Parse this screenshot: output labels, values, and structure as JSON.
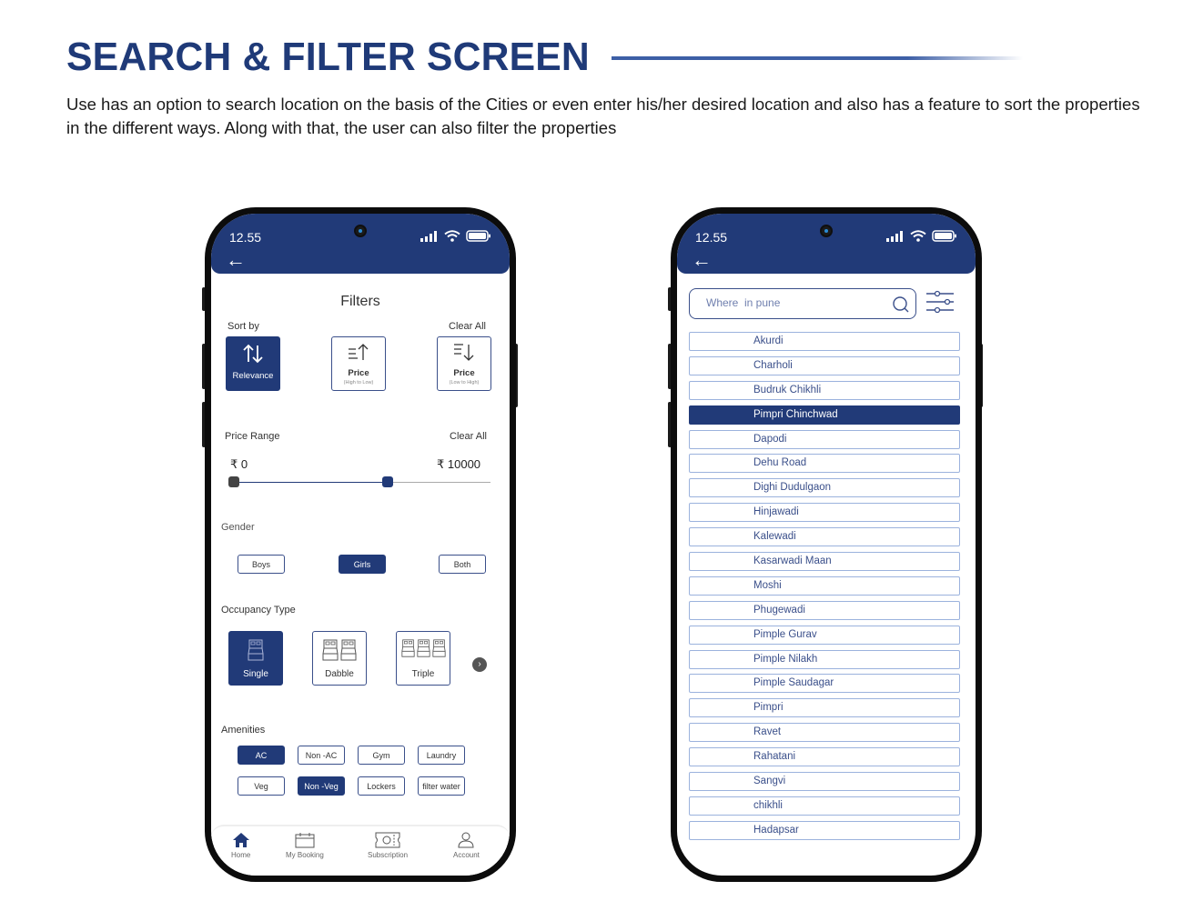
{
  "page": {
    "title": "SEARCH & FILTER SCREEN",
    "description": "Use has an option to search location on the basis of the Cities or even enter his/her desired location and also has a feature to sort the properties in the different ways. Along with that, the user can also filter the properties"
  },
  "colors": {
    "primary": "#213a78",
    "outline": "#3a4f8a",
    "list_border": "#9bb2dd"
  },
  "filter_screen": {
    "status_time": "12.55",
    "title": "Filters",
    "sort": {
      "label": "Sort by",
      "clear": "Clear All",
      "options": [
        {
          "icon": "sort-arrows-icon",
          "label": "Relevance",
          "sub": "",
          "selected": true
        },
        {
          "icon": "sort-ascending-icon",
          "label": "Price",
          "sub": "(High to Low)",
          "selected": false
        },
        {
          "icon": "sort-descending-icon",
          "label": "Price",
          "sub": "(Low to High)",
          "selected": false
        }
      ]
    },
    "price_range": {
      "label": "Price Range",
      "clear": "Clear All",
      "min_label": "₹ 0",
      "max_label": "₹ 10000",
      "min": 0,
      "max": 10000,
      "selected_min_fraction": 0.0,
      "selected_max_fraction": 0.6
    },
    "gender": {
      "label": "Gender",
      "options": [
        {
          "label": "Boys",
          "selected": false
        },
        {
          "label": "Girls",
          "selected": true
        },
        {
          "label": "Both",
          "selected": false
        }
      ]
    },
    "occupancy": {
      "label": "Occupancy Type",
      "options": [
        {
          "label": "Single",
          "beds": 1,
          "selected": true
        },
        {
          "label": "Dabble",
          "beds": 2,
          "selected": false
        },
        {
          "label": "Triple",
          "beds": 3,
          "selected": false
        }
      ],
      "next_icon": "chevron-right-icon"
    },
    "amenities": {
      "label": "Amenities",
      "options": [
        {
          "label": "AC",
          "selected": true
        },
        {
          "label": "Non -AC",
          "selected": false
        },
        {
          "label": "Gym",
          "selected": false
        },
        {
          "label": "Laundry",
          "selected": false
        },
        {
          "label": "Veg",
          "selected": false
        },
        {
          "label": "Non -Veg",
          "selected": true
        },
        {
          "label": "Lockers",
          "selected": false
        },
        {
          "label": "filter water",
          "selected": false
        }
      ]
    },
    "nav": [
      {
        "label": "Home",
        "icon": "home-icon",
        "active": true
      },
      {
        "label": "My Booking",
        "icon": "calendar-icon",
        "active": false
      },
      {
        "label": "Subscription",
        "icon": "ticket-icon",
        "active": false
      },
      {
        "label": "Account",
        "icon": "user-icon",
        "active": false
      }
    ]
  },
  "search_screen": {
    "status_time": "12.55",
    "search": {
      "placeholder": "Where  in pune",
      "value": ""
    },
    "locations": [
      {
        "name": "Akurdi",
        "selected": false
      },
      {
        "name": "Charholi",
        "selected": false
      },
      {
        "name": "Budruk Chikhli",
        "selected": false
      },
      {
        "name": "Pimpri Chinchwad",
        "selected": true
      },
      {
        "name": "Dapodi",
        "selected": false
      },
      {
        "name": "Dehu Road",
        "selected": false
      },
      {
        "name": "Dighi Dudulgaon",
        "selected": false
      },
      {
        "name": "Hinjawadi",
        "selected": false
      },
      {
        "name": "Kalewadi",
        "selected": false
      },
      {
        "name": "Kasarwadi Maan",
        "selected": false
      },
      {
        "name": "Moshi",
        "selected": false
      },
      {
        "name": "Phugewadi",
        "selected": false
      },
      {
        "name": "Pimple Gurav",
        "selected": false
      },
      {
        "name": "Pimple Nilakh",
        "selected": false
      },
      {
        "name": "Pimple Saudagar",
        "selected": false
      },
      {
        "name": "Pimpri",
        "selected": false
      },
      {
        "name": "Ravet",
        "selected": false
      },
      {
        "name": "Rahatani",
        "selected": false
      },
      {
        "name": "Sangvi",
        "selected": false
      },
      {
        "name": "chikhli",
        "selected": false
      },
      {
        "name": "Hadapsar",
        "selected": false
      }
    ]
  }
}
